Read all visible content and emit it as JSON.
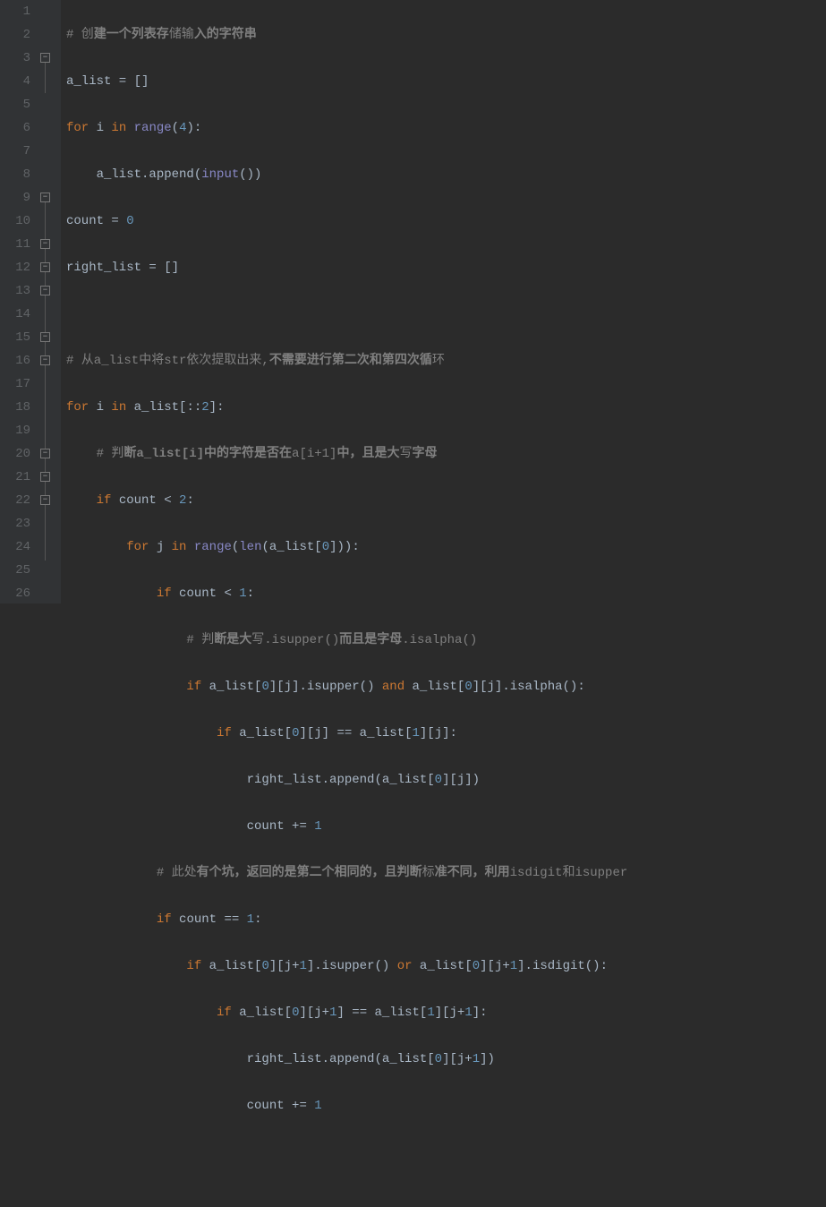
{
  "line_numbers": [
    "1",
    "2",
    "3",
    "4",
    "5",
    "6",
    "7",
    "8",
    "9",
    "10",
    "11",
    "12",
    "13",
    "14",
    "15",
    "16",
    "17",
    "18",
    "19",
    "20",
    "21",
    "22",
    "23",
    "24",
    "25",
    "26"
  ],
  "code": {
    "l1": {
      "c1": "# 创",
      "c2": "建一个列表存",
      "c3": "储输",
      "c4": "入的字符串"
    },
    "l2": {
      "t1": "a_list = []"
    },
    "l3": {
      "k1": "for ",
      "t1": "i ",
      "k2": "in ",
      "f1": "range",
      "t2": "(",
      "n1": "4",
      "t3": "):"
    },
    "l4": {
      "t1": "    a_list.append(",
      "b1": "input",
      "t2": "())"
    },
    "l5": {
      "t1": "count = ",
      "n1": "0"
    },
    "l6": {
      "t1": "right_list = []"
    },
    "l8": {
      "c1": "# 从a_list中将str依次提取出来,",
      "c2": "不需要进行第二次和第四次循",
      "c3": "环"
    },
    "l9": {
      "k1": "for ",
      "t1": "i ",
      "k2": "in ",
      "t2": "a_list[::",
      "n1": "2",
      "t3": "]:"
    },
    "l10": {
      "t1": "    ",
      "c1": "# 判",
      "c2": "断a_list[i]",
      "c3": "中的字符是否在",
      "c4": "a[i+1]",
      "c5": "中，且是大",
      "c6": "写",
      "c7": "字母"
    },
    "l11": {
      "t1": "    ",
      "k1": "if ",
      "t2": "count < ",
      "n1": "2",
      "t3": ":"
    },
    "l12": {
      "t1": "        ",
      "k1": "for ",
      "t2": "j ",
      "k2": "in ",
      "f1": "range",
      "t3": "(",
      "b1": "len",
      "t4": "(a_list[",
      "n1": "0",
      "t5": "])):"
    },
    "l13": {
      "t1": "            ",
      "k1": "if ",
      "t2": "count < ",
      "n1": "1",
      "t3": ":"
    },
    "l14": {
      "t1": "                ",
      "c1": "# 判",
      "c2": "断是大",
      "c3": "写.isupper()",
      "c4": "而且是字母",
      "c5": ".isalpha()"
    },
    "l15": {
      "t1": "                ",
      "k1": "if ",
      "t2": "a_list[",
      "n1": "0",
      "t3": "][j].isupper() ",
      "k2": "and ",
      "t4": "a_list[",
      "n2": "0",
      "t5": "][j].isalpha():"
    },
    "l16": {
      "t1": "                    ",
      "k1": "if ",
      "t2": "a_list[",
      "n1": "0",
      "t3": "][j] == a_list[",
      "n2": "1",
      "t4": "][j]:"
    },
    "l17": {
      "t1": "                        right_list.append(a_list[",
      "n1": "0",
      "t2": "][j])"
    },
    "l18": {
      "t1": "                        count += ",
      "n1": "1"
    },
    "l19": {
      "t1": "            ",
      "c1": "# 此处",
      "c2": "有个坑，返回的是第二个相同的，且判断",
      "c3": "标",
      "c4": "准不同，利用",
      "c5": "isdigit和isupper"
    },
    "l20": {
      "t1": "            ",
      "k1": "if ",
      "t2": "count == ",
      "n1": "1",
      "t3": ":"
    },
    "l21": {
      "t1": "                ",
      "k1": "if ",
      "t2": "a_list[",
      "n1": "0",
      "t3": "][j+",
      "n2": "1",
      "t4": "].isupper() ",
      "k2": "or ",
      "t5": "a_list[",
      "n3": "0",
      "t6": "][j+",
      "n4": "1",
      "t7": "].isdigit():"
    },
    "l22": {
      "t1": "                    ",
      "k1": "if ",
      "t2": "a_list[",
      "n1": "0",
      "t3": "][j+",
      "n2": "1",
      "t4": "] == a_list[",
      "n3": "1",
      "t5": "][j+",
      "n4": "1",
      "t6": "]:"
    },
    "l23": {
      "t1": "                        right_list.append(a_list[",
      "n1": "0",
      "t2": "][j+",
      "n2": "1",
      "t3": "])"
    },
    "l24": {
      "t1": "                        count += ",
      "n1": "1"
    }
  }
}
